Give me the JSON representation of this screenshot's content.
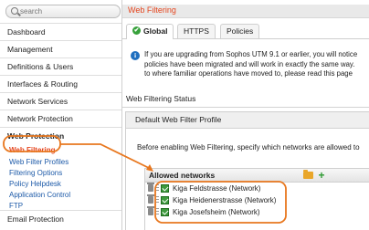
{
  "search": {
    "placeholder": "search"
  },
  "sidebar": {
    "items": [
      {
        "label": "Dashboard"
      },
      {
        "label": "Management"
      },
      {
        "label": "Definitions & Users"
      },
      {
        "label": "Interfaces & Routing"
      },
      {
        "label": "Network Services"
      },
      {
        "label": "Network Protection"
      }
    ],
    "section_label": "Web Protection",
    "sub_items": [
      {
        "label": "Web Filtering",
        "active": true
      },
      {
        "label": "Web Filter Profiles"
      },
      {
        "label": "Filtering Options"
      },
      {
        "label": "Policy Helpdesk"
      },
      {
        "label": "Application Control"
      },
      {
        "label": "FTP"
      }
    ],
    "bottom_item": "Email Protection"
  },
  "header": {
    "title": "Web Filtering"
  },
  "tabs": [
    {
      "label": "Global",
      "active": true,
      "icon": "check-circle-icon"
    },
    {
      "label": "HTTPS"
    },
    {
      "label": "Policies"
    }
  ],
  "info": {
    "lines": [
      "If you are upgrading from Sophos UTM 9.1 or earlier, you will notice",
      "policies have been migrated and will work in exactly the same way.",
      "to where familiar operations have moved to, please read this page"
    ]
  },
  "status": {
    "title": "Web Filtering Status"
  },
  "profile": {
    "header": "Default Web Filter Profile",
    "description": "Before enabling Web Filtering, specify which networks are allowed to",
    "allowed_header": "Allowed networks",
    "networks": [
      "Kiga Feldstrasse (Network)",
      "Kiga Heidenerstrasse (Network)",
      "Kiga Josefsheim (Network)"
    ]
  },
  "colors": {
    "accent_orange": "#e5461e",
    "link_blue": "#1d5aa8",
    "network_green": "#3e9a3e",
    "annotation": "#e8771e"
  }
}
